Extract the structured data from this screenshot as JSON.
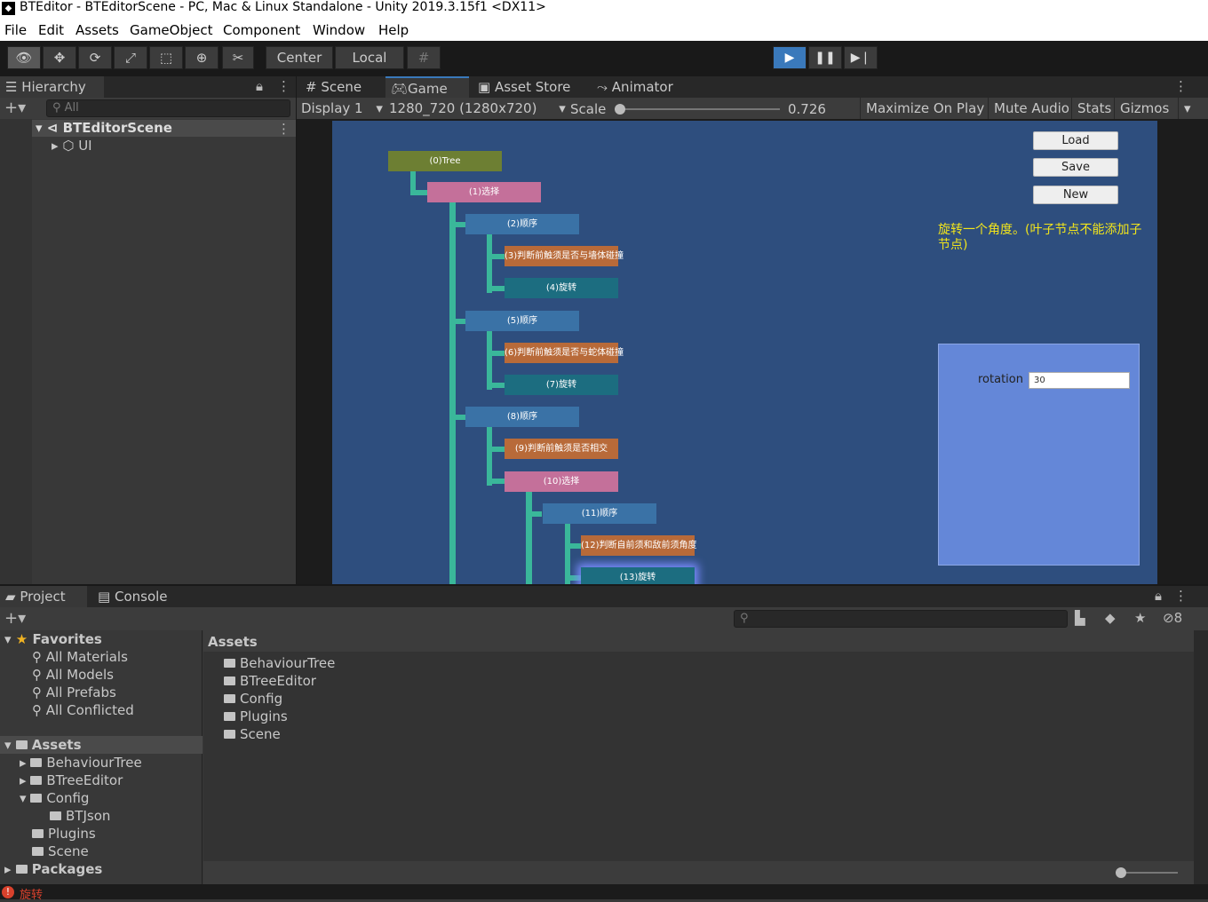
{
  "window": {
    "title": "BTEditor - BTEditorScene - PC, Mac & Linux Standalone - Unity 2019.3.15f1 <DX11>"
  },
  "menu": [
    "File",
    "Edit",
    "Assets",
    "GameObject",
    "Component",
    "Window",
    "Help"
  ],
  "toolbar": {
    "pivot": "Center",
    "space": "Local"
  },
  "hierarchy": {
    "tab": "Hierarchy",
    "search_placeholder": "All",
    "scene": "BTEditorScene",
    "child": "UI"
  },
  "tabs": {
    "scene": "Scene",
    "game": "Game",
    "asset_store": "Asset Store",
    "animator": "Animator"
  },
  "game_bar": {
    "display": "Display 1",
    "resolution": "1280_720 (1280x720)",
    "scale_label": "Scale",
    "scale_value": "0.726",
    "maximize": "Maximize On Play",
    "mute": "Mute Audio",
    "stats": "Stats",
    "gizmos": "Gizmos"
  },
  "game_view": {
    "buttons": {
      "load": "Load",
      "save": "Save",
      "new": "New"
    },
    "description": "旋转一个角度。(叶子节点不能添加子节点)",
    "property_label": "rotation",
    "property_value": "30",
    "nodes": {
      "n0": "(0)Tree",
      "n1": "(1)选择",
      "n2": "(2)顺序",
      "n3": "(3)判断前触须是否与墙体碰撞",
      "n4": "(4)旋转",
      "n5": "(5)顺序",
      "n6": "(6)判断前触须是否与蛇体碰撞",
      "n7": "(7)旋转",
      "n8": "(8)顺序",
      "n9": "(9)判断前触须是否相交",
      "n10": "(10)选择",
      "n11": "(11)顺序",
      "n12": "(12)判断自前须和敌前须角度",
      "n13": "(13)旋转"
    }
  },
  "project": {
    "tab_project": "Project",
    "tab_console": "Console",
    "hidden_count": "8",
    "favorites": {
      "label": "Favorites",
      "items": [
        "All Materials",
        "All Models",
        "All Prefabs",
        "All Conflicted"
      ]
    },
    "assets_tree": {
      "label": "Assets",
      "items": [
        "BehaviourTree",
        "BTreeEditor",
        "Config",
        "BTJson",
        "Plugins",
        "Scene"
      ]
    },
    "packages": "Packages",
    "breadcrumb": "Assets",
    "content": [
      "BehaviourTree",
      "BTreeEditor",
      "Config",
      "Plugins",
      "Scene"
    ]
  },
  "status": {
    "message": "旋转"
  },
  "colors": {
    "play_active": "#3a79bb",
    "canvas_bg": "#2e4e7e",
    "connector": "#3ab79a",
    "description_text": "#f2e51b",
    "inspector_panel": "#6487d8"
  }
}
